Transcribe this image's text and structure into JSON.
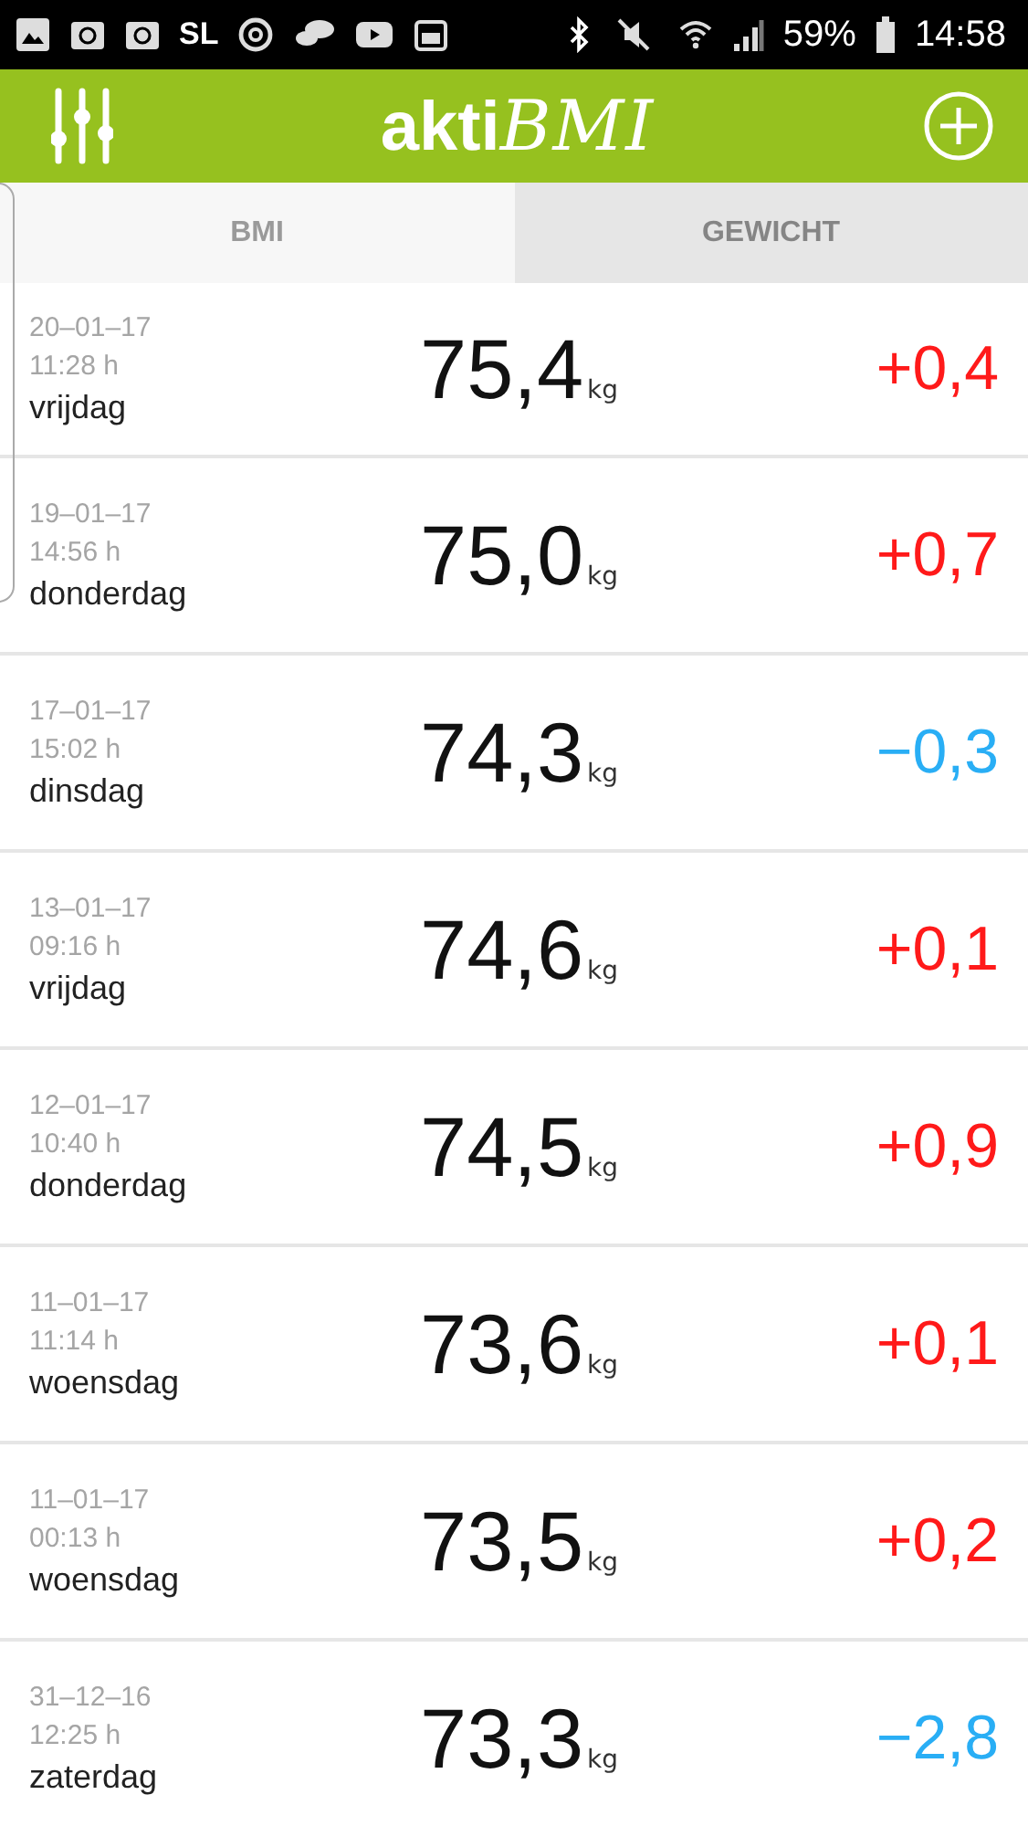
{
  "status_bar": {
    "carrier": "SL",
    "battery": "59%",
    "time": "14:58"
  },
  "header": {
    "logo": {
      "plain": "akti",
      "script": "BMI"
    }
  },
  "tabs": [
    {
      "label": "BMI",
      "selected": false
    },
    {
      "label": "GEWICHT",
      "selected": true
    }
  ],
  "entries": [
    {
      "date": "20–01–17",
      "time": "11:28 h",
      "day": "vrijdag",
      "weight": "75,4",
      "unit": "kg",
      "delta": "+0,4",
      "color": "#ff1a1a"
    },
    {
      "date": "19–01–17",
      "time": "14:56 h",
      "day": "donderdag",
      "weight": "75,0",
      "unit": "kg",
      "delta": "+0,7",
      "color": "#ff1a1a"
    },
    {
      "date": "17–01–17",
      "time": "15:02 h",
      "day": "dinsdag",
      "weight": "74,3",
      "unit": "kg",
      "delta": "−0,3",
      "color": "#29aef5"
    },
    {
      "date": "13–01–17",
      "time": "09:16 h",
      "day": "vrijdag",
      "weight": "74,6",
      "unit": "kg",
      "delta": "+0,1",
      "color": "#ff1a1a"
    },
    {
      "date": "12–01–17",
      "time": "10:40 h",
      "day": "donderdag",
      "weight": "74,5",
      "unit": "kg",
      "delta": "+0,9",
      "color": "#ff1a1a"
    },
    {
      "date": "11–01–17",
      "time": "11:14 h",
      "day": "woensdag",
      "weight": "73,6",
      "unit": "kg",
      "delta": "+0,1",
      "color": "#ff1a1a"
    },
    {
      "date": "11–01–17",
      "time": "00:13 h",
      "day": "woensdag",
      "weight": "73,5",
      "unit": "kg",
      "delta": "+0,2",
      "color": "#ff1a1a"
    },
    {
      "date": "31–12–16",
      "time": "12:25 h",
      "day": "zaterdag",
      "weight": "73,3",
      "unit": "kg",
      "delta": "−2,8",
      "color": "#29aef5"
    }
  ]
}
